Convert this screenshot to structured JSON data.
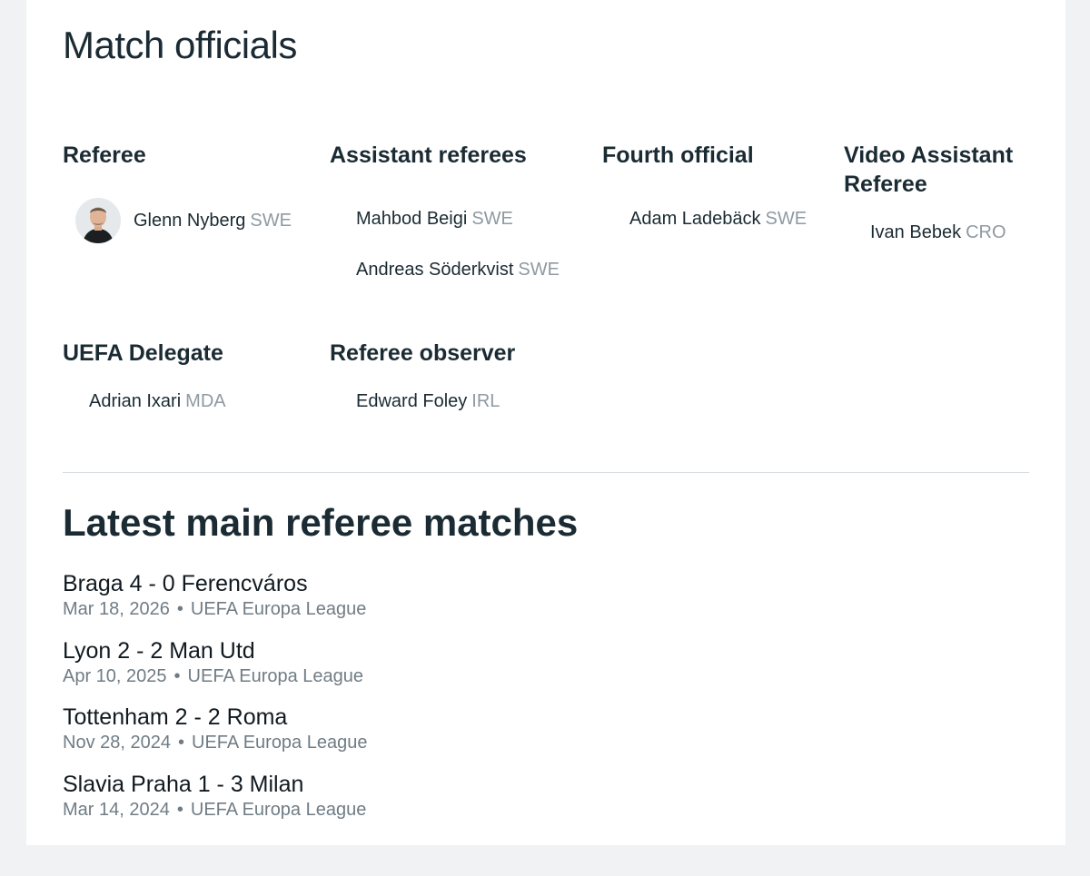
{
  "officials": {
    "title": "Match officials",
    "groups": {
      "referee": {
        "heading": "Referee",
        "people": [
          {
            "name": "Glenn Nyberg",
            "nat": "SWE"
          }
        ]
      },
      "assistants": {
        "heading": "Assistant referees",
        "people": [
          {
            "name": "Mahbod Beigi",
            "nat": "SWE"
          },
          {
            "name": "Andreas Söderkvist",
            "nat": "SWE"
          }
        ]
      },
      "fourth": {
        "heading": "Fourth official",
        "people": [
          {
            "name": "Adam Ladebäck",
            "nat": "SWE"
          }
        ]
      },
      "var": {
        "heading_line1": "Video Assistant",
        "heading_line2": "Referee",
        "people": [
          {
            "name": "Ivan Bebek",
            "nat": "CRO"
          }
        ]
      },
      "delegate": {
        "heading": "UEFA Delegate",
        "people": [
          {
            "name": "Adrian Ixari",
            "nat": "MDA"
          }
        ]
      },
      "observer": {
        "heading": "Referee observer",
        "people": [
          {
            "name": "Edward Foley",
            "nat": "IRL"
          }
        ]
      }
    }
  },
  "latest": {
    "title": "Latest main referee matches",
    "separator": "•",
    "matches": [
      {
        "title": "Braga 4 - 0 Ferencváros",
        "date": "Mar 18, 2026",
        "competition": "UEFA Europa League"
      },
      {
        "title": "Lyon 2 - 2 Man Utd",
        "date": "Apr 10, 2025",
        "competition": "UEFA Europa League"
      },
      {
        "title": "Tottenham 2 - 2 Roma",
        "date": "Nov 28, 2024",
        "competition": "UEFA Europa League"
      },
      {
        "title": "Slavia Praha 1 - 3 Milan",
        "date": "Mar 14, 2024",
        "competition": "UEFA Europa League"
      }
    ]
  }
}
